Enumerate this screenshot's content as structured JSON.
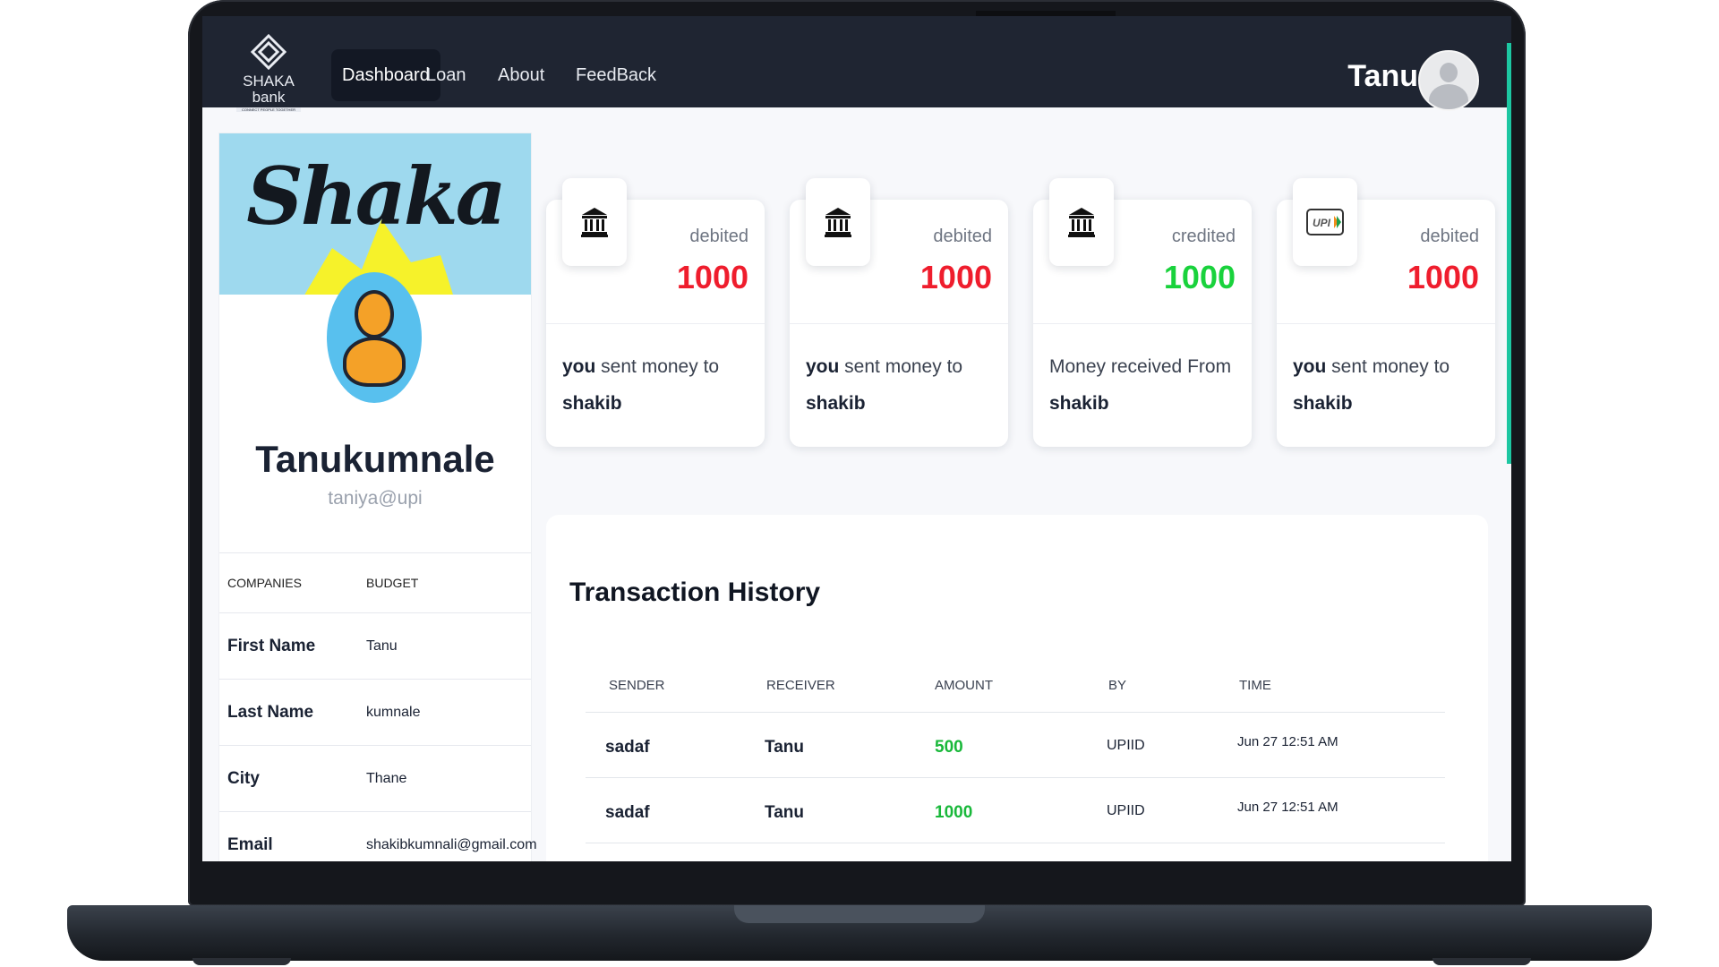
{
  "brand": {
    "name": "SHAKA bank",
    "tagline": "CONNECT PEOPLE TOGETHER",
    "banner_text": "Shaka"
  },
  "nav": {
    "links": [
      {
        "label": "Dashboard",
        "active": true
      },
      {
        "label": "Loan",
        "active": false
      },
      {
        "label": "About",
        "active": false
      },
      {
        "label": "FeedBack",
        "active": false
      }
    ],
    "user_name": "Tanu"
  },
  "profile": {
    "name": "Tanukumnale",
    "upi": "taniya@upi",
    "table_header": {
      "key": "COMPANIES",
      "value": "BUDGET"
    },
    "fields": [
      {
        "key": "First Name",
        "value": "Tanu"
      },
      {
        "key": "Last Name",
        "value": "kumnale"
      },
      {
        "key": "City",
        "value": "Thane"
      },
      {
        "key": "Email",
        "value": "shakibkumnali@gmail.com"
      }
    ]
  },
  "transactions": [
    {
      "icon": "bank-icon",
      "status": "debited",
      "amount": "1000",
      "type": "debit",
      "desc_prefix": "you",
      "desc_mid": " sent money to ",
      "desc_target": "shakib"
    },
    {
      "icon": "bank-icon",
      "status": "debited",
      "amount": "1000",
      "type": "debit",
      "desc_prefix": "you",
      "desc_mid": " sent money to ",
      "desc_target": "shakib"
    },
    {
      "icon": "bank-icon",
      "status": "credited",
      "amount": "1000",
      "type": "credit",
      "desc_prefix": "",
      "desc_mid": "Money received From ",
      "desc_target": "shakib"
    },
    {
      "icon": "upi-icon",
      "status": "debited",
      "amount": "1000",
      "type": "debit",
      "desc_prefix": "you",
      "desc_mid": " sent money to ",
      "desc_target": "shakib"
    }
  ],
  "upi_logo_text": "UPI",
  "history": {
    "title": "Transaction History",
    "columns": [
      "SENDER",
      "RECEIVER",
      "AMOUNT",
      "BY",
      "TIME"
    ],
    "rows": [
      {
        "sender": "sadaf",
        "receiver": "Tanu",
        "amount": "500",
        "by": "UPIID",
        "time": "Jun 27 12:51 AM"
      },
      {
        "sender": "sadaf",
        "receiver": "Tanu",
        "amount": "1000",
        "by": "UPIID",
        "time": "Jun 27 12:51 AM"
      }
    ]
  },
  "colors": {
    "navbar": "#1f2532",
    "debit": "#ef1d2d",
    "credit": "#19d23c",
    "history_amount": "#19b83a"
  }
}
